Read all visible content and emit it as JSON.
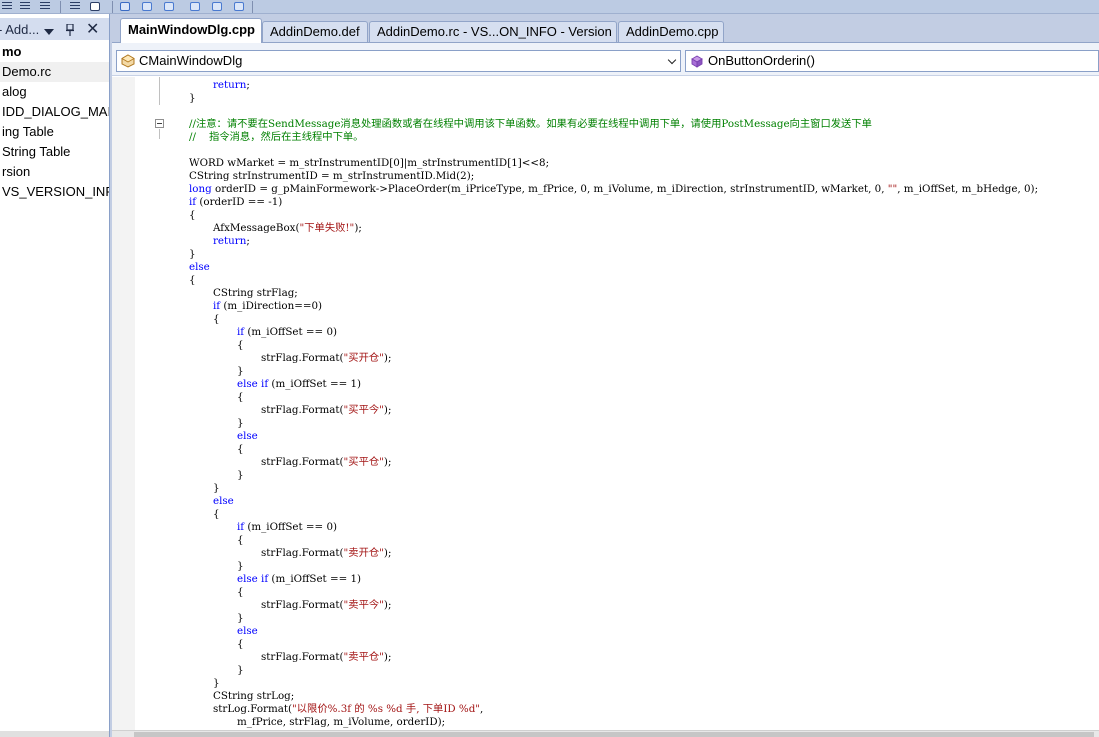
{
  "toolbar": {
    "icons": [
      "indent-icon",
      "outdent-icon",
      "comment-icon",
      "uncomment-icon",
      "window-icon",
      "bookmark-icon",
      "bookmark-prev-icon",
      "bookmark-next-icon",
      "bookmark-clear-icon",
      "find-icon",
      "more-icon"
    ]
  },
  "left_panel": {
    "title": "- Add...",
    "items": [
      {
        "label": "mo",
        "bold": true
      },
      {
        "label": "Demo.rc",
        "selected": true
      },
      {
        "label": "alog"
      },
      {
        "label": "IDD_DIALOG_MAIN"
      },
      {
        "label": "ing Table"
      },
      {
        "label": "String Table"
      },
      {
        "label": "rsion"
      },
      {
        "label": "VS_VERSION_INFO"
      }
    ]
  },
  "tabs": [
    {
      "label": "MainWindowDlg.cpp",
      "active": true
    },
    {
      "label": "AddinDemo.def"
    },
    {
      "label": "AddinDemo.rc - VS...ON_INFO - Version"
    },
    {
      "label": "AddinDemo.cpp"
    }
  ],
  "nav": {
    "class_combo": "CMainWindowDlg",
    "method_combo": "OnButtonOrderin()"
  },
  "code_lines": [
    {
      "indent": 2,
      "segs": [
        [
          "kw",
          "return"
        ],
        [
          "t",
          ";"
        ]
      ]
    },
    {
      "indent": 1,
      "segs": [
        [
          "t",
          "}"
        ]
      ]
    },
    {
      "indent": 0,
      "segs": []
    },
    {
      "indent": 1,
      "cm": true,
      "segs": [
        [
          "t",
          "//注意：请不要在SendMessage消息处理函数或者在线程中调用该下单函数。如果有必要在线程中调用下单，请使用PostMessage向主窗口发送下单"
        ]
      ]
    },
    {
      "indent": 1,
      "cm": true,
      "segs": [
        [
          "t",
          "//    指令消息，然后在主线程中下单。"
        ]
      ]
    },
    {
      "indent": 0,
      "segs": []
    },
    {
      "indent": 1,
      "segs": [
        [
          "t",
          "WORD wMarket = m_strInstrumentID[0]|m_strInstrumentID[1]<<8;"
        ]
      ]
    },
    {
      "indent": 1,
      "segs": [
        [
          "t",
          "CString strInstrumentID = m_strInstrumentID.Mid(2);"
        ]
      ]
    },
    {
      "indent": 1,
      "segs": [
        [
          "kw",
          "long"
        ],
        [
          "t",
          " orderID = g_pMainFormework->PlaceOrder(m_iPriceType, m_fPrice, 0, m_iVolume, m_iDirection, strInstrumentID, wMarket, 0, "
        ],
        [
          "str",
          "\"\""
        ],
        [
          "t",
          ", m_iOffSet, m_bHedge, 0);"
        ]
      ]
    },
    {
      "indent": 1,
      "segs": [
        [
          "kw",
          "if"
        ],
        [
          "t",
          " (orderID == -1)"
        ]
      ]
    },
    {
      "indent": 1,
      "segs": [
        [
          "t",
          "{"
        ]
      ]
    },
    {
      "indent": 2,
      "segs": [
        [
          "t",
          "AfxMessageBox("
        ],
        [
          "str",
          "\"下单失败!\""
        ],
        [
          "t",
          ");"
        ]
      ]
    },
    {
      "indent": 2,
      "segs": [
        [
          "kw",
          "return"
        ],
        [
          "t",
          ";"
        ]
      ]
    },
    {
      "indent": 1,
      "segs": [
        [
          "t",
          "}"
        ]
      ]
    },
    {
      "indent": 1,
      "segs": [
        [
          "kw",
          "else"
        ]
      ]
    },
    {
      "indent": 1,
      "segs": [
        [
          "t",
          "{"
        ]
      ]
    },
    {
      "indent": 2,
      "segs": [
        [
          "t",
          "CString strFlag;"
        ]
      ]
    },
    {
      "indent": 2,
      "segs": [
        [
          "kw",
          "if"
        ],
        [
          "t",
          " (m_iDirection==0)"
        ]
      ]
    },
    {
      "indent": 2,
      "segs": [
        [
          "t",
          "{"
        ]
      ]
    },
    {
      "indent": 3,
      "segs": [
        [
          "kw",
          "if"
        ],
        [
          "t",
          " (m_iOffSet == 0)"
        ]
      ]
    },
    {
      "indent": 3,
      "segs": [
        [
          "t",
          "{"
        ]
      ]
    },
    {
      "indent": 4,
      "segs": [
        [
          "t",
          "strFlag.Format("
        ],
        [
          "str",
          "\"买开仓\""
        ],
        [
          "t",
          ");"
        ]
      ]
    },
    {
      "indent": 3,
      "segs": [
        [
          "t",
          "}"
        ]
      ]
    },
    {
      "indent": 3,
      "segs": [
        [
          "kw",
          "else if"
        ],
        [
          "t",
          " (m_iOffSet == 1)"
        ]
      ]
    },
    {
      "indent": 3,
      "segs": [
        [
          "t",
          "{"
        ]
      ]
    },
    {
      "indent": 4,
      "segs": [
        [
          "t",
          "strFlag.Format("
        ],
        [
          "str",
          "\"买平今\""
        ],
        [
          "t",
          ");"
        ]
      ]
    },
    {
      "indent": 3,
      "segs": [
        [
          "t",
          "}"
        ]
      ]
    },
    {
      "indent": 3,
      "segs": [
        [
          "kw",
          "else"
        ]
      ]
    },
    {
      "indent": 3,
      "segs": [
        [
          "t",
          "{"
        ]
      ]
    },
    {
      "indent": 4,
      "segs": [
        [
          "t",
          "strFlag.Format("
        ],
        [
          "str",
          "\"买平仓\""
        ],
        [
          "t",
          ");"
        ]
      ]
    },
    {
      "indent": 3,
      "segs": [
        [
          "t",
          "}"
        ]
      ]
    },
    {
      "indent": 2,
      "segs": [
        [
          "t",
          "}"
        ]
      ]
    },
    {
      "indent": 2,
      "segs": [
        [
          "kw",
          "else"
        ]
      ]
    },
    {
      "indent": 2,
      "segs": [
        [
          "t",
          "{"
        ]
      ]
    },
    {
      "indent": 3,
      "segs": [
        [
          "kw",
          "if"
        ],
        [
          "t",
          " (m_iOffSet == 0)"
        ]
      ]
    },
    {
      "indent": 3,
      "segs": [
        [
          "t",
          "{"
        ]
      ]
    },
    {
      "indent": 4,
      "segs": [
        [
          "t",
          "strFlag.Format("
        ],
        [
          "str",
          "\"卖开仓\""
        ],
        [
          "t",
          ");"
        ]
      ]
    },
    {
      "indent": 3,
      "segs": [
        [
          "t",
          "}"
        ]
      ]
    },
    {
      "indent": 3,
      "segs": [
        [
          "kw",
          "else if"
        ],
        [
          "t",
          " (m_iOffSet == 1)"
        ]
      ]
    },
    {
      "indent": 3,
      "segs": [
        [
          "t",
          "{"
        ]
      ]
    },
    {
      "indent": 4,
      "segs": [
        [
          "t",
          "strFlag.Format("
        ],
        [
          "str",
          "\"卖平今\""
        ],
        [
          "t",
          ");"
        ]
      ]
    },
    {
      "indent": 3,
      "segs": [
        [
          "t",
          "}"
        ]
      ]
    },
    {
      "indent": 3,
      "segs": [
        [
          "kw",
          "else"
        ]
      ]
    },
    {
      "indent": 3,
      "segs": [
        [
          "t",
          "{"
        ]
      ]
    },
    {
      "indent": 4,
      "segs": [
        [
          "t",
          "strFlag.Format("
        ],
        [
          "str",
          "\"卖平仓\""
        ],
        [
          "t",
          ");"
        ]
      ]
    },
    {
      "indent": 3,
      "segs": [
        [
          "t",
          "}"
        ]
      ]
    },
    {
      "indent": 2,
      "segs": [
        [
          "t",
          "}"
        ]
      ]
    },
    {
      "indent": 2,
      "segs": [
        [
          "t",
          "CString strLog;"
        ]
      ]
    },
    {
      "indent": 2,
      "segs": [
        [
          "t",
          "strLog.Format("
        ],
        [
          "str",
          "\"以限价%.3f 的 %s %d 手, 下单ID %d\""
        ],
        [
          "t",
          ","
        ]
      ]
    },
    {
      "indent": 3,
      "segs": [
        [
          "t",
          "m_fPrice, strFlag, m_iVolume, orderID);"
        ]
      ]
    }
  ]
}
